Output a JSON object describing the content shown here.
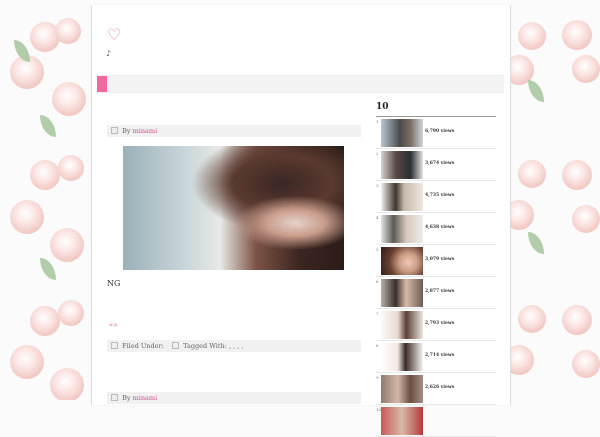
{
  "site": {
    "logo_symbol": "♡",
    "tagline": "♪"
  },
  "posts": [
    {
      "meta_prefix": "By",
      "author": "minami",
      "excerpt": "NG",
      "readmore": "«»",
      "filed_under_label": "Filed Under:",
      "tagged_with_label": "Tagged With: , , , ,"
    },
    {
      "meta_prefix": "By",
      "author": "minami"
    }
  ],
  "sidebar": {
    "title": "10",
    "ranking": [
      {
        "rank": "1",
        "views": "6,790 views"
      },
      {
        "rank": "2",
        "views": "3,674 views"
      },
      {
        "rank": "3",
        "views": "4,735 views"
      },
      {
        "rank": "4",
        "views": "4,638 views"
      },
      {
        "rank": "5",
        "views": "3,079 views"
      },
      {
        "rank": "6",
        "views": "2,877 views"
      },
      {
        "rank": "7",
        "views": "2,793 views"
      },
      {
        "rank": "8",
        "views": "2,714 views"
      },
      {
        "rank": "9",
        "views": "2,626 views"
      },
      {
        "rank": "10",
        "views": ""
      }
    ]
  },
  "colors": {
    "accent": "#f06aa0",
    "link": "#d14f8d"
  }
}
